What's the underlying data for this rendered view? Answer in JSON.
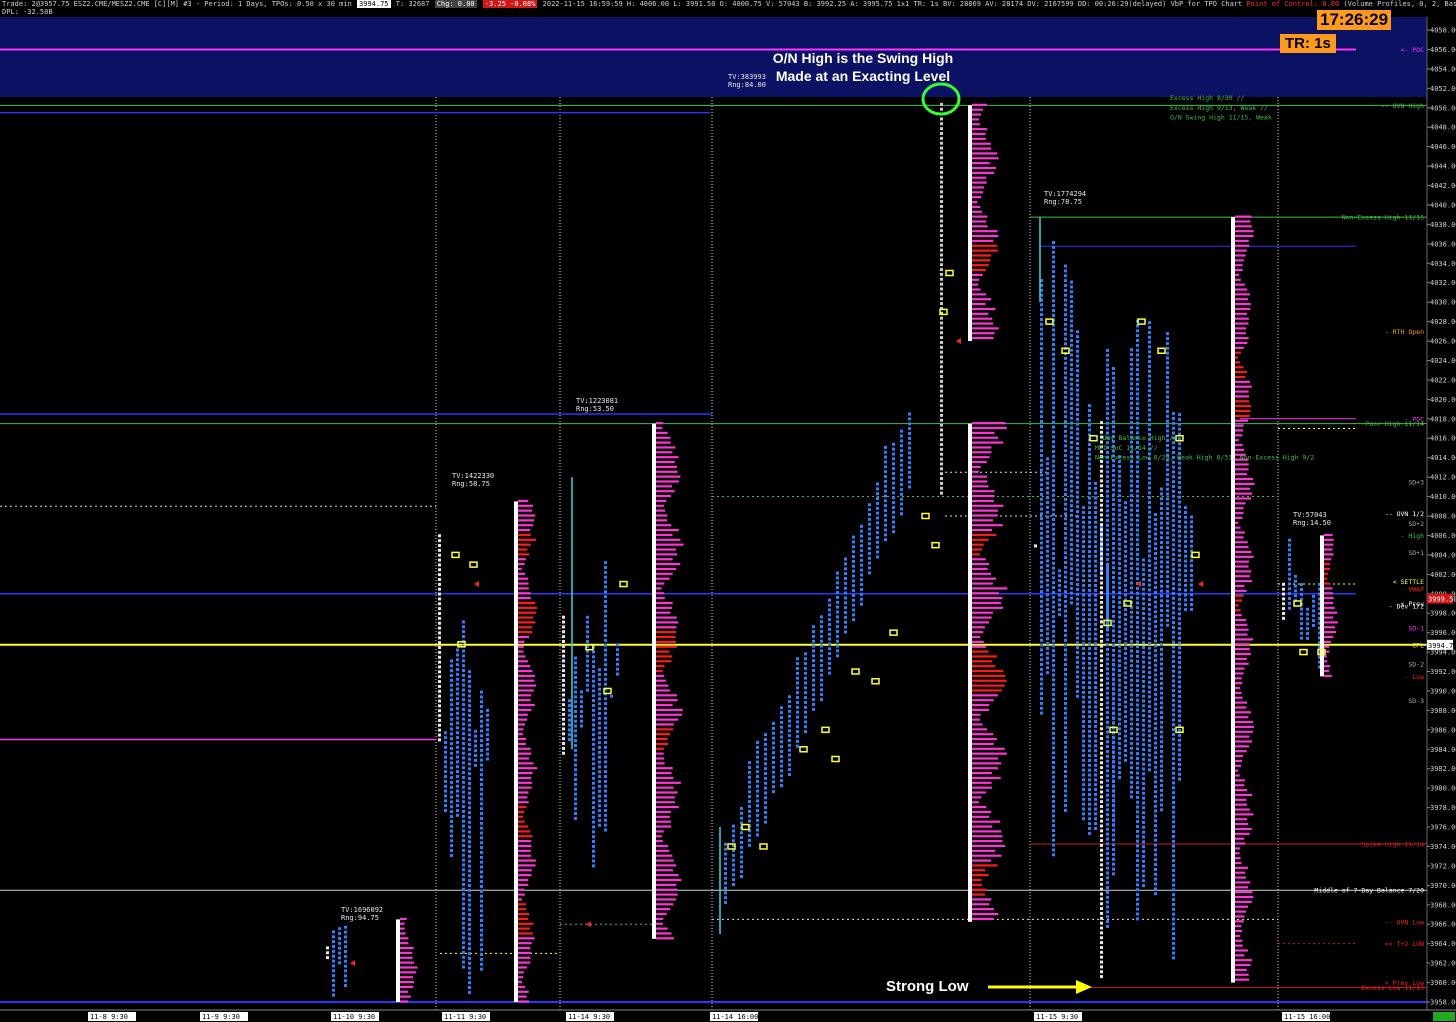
{
  "header": {
    "trade_text": "Trade: 2@3957.75 ESZ2.CME/MESZ2.CME [C][M] #3 - Period: 1 Days, TPOs: 0.50 x 30 min",
    "price_chip": "3994.75",
    "t_text": "T: 32687",
    "chg_text": "Chg: 0.00",
    "neg_chip": "-3.25 -0.08%",
    "info_text": "2022-11-15 16:59:59 H: 4006.00 L: 3991.50 O: 4000.75 V: 57043 B: 3992.25 A: 3995.75 1x1 TR: 1s BV: 28869 AV: 28174 DV: 2167599 DD: 00:26:29(delayed) VbP for TPO Chart",
    "poc_text": "Point of Control: 0.00",
    "vp_text": "(Volume Profiles, 0, 2, Based On TPO Chart, No, Days, 1, 50, 1000000, 0, 0, No, 00:00:00, 0, 00:00:00, No, No, No, Window Width,",
    "second_row": "DPL: -32.50B"
  },
  "clock": "17:26:29",
  "tr_box": "TR: 1s",
  "annotations": {
    "title_line1": "O/N High is the Swing High",
    "title_line2": "Made at an Exacting Level",
    "strong_low": "Strong Low"
  },
  "colors": {
    "background": "#000000",
    "header_band": "#0b1163",
    "accent_orange": "#ff9a1f",
    "tpo_blue": "#2f7fff",
    "volume_magenta": "#ff33d6",
    "volume_red": "#ff1a1a",
    "level_green": "#3fbf3f",
    "level_blue": "#2a35ff",
    "level_yellow": "#ffff33",
    "level_magenta": "#ff33ff",
    "level_red": "#c81e1e",
    "poc_box": "#ffff33"
  },
  "icons": {
    "highlight_circle": "green-circle-icon",
    "arrow": "yellow-right-arrow-icon"
  },
  "chart_data": {
    "type": "tpo-profile",
    "title": "",
    "price_axis": {
      "min": 3958.0,
      "max": 4058.0,
      "ticks": [
        "4058.00",
        "4056.00",
        "4054.00",
        "4052.00",
        "4050.00",
        "4048.00",
        "4046.00",
        "4044.00",
        "4042.00",
        "4040.00",
        "4038.00",
        "4036.00",
        "4034.00",
        "4032.00",
        "4030.00",
        "4028.00",
        "4026.00",
        "4024.00",
        "4022.00",
        "4020.00",
        "4018.00",
        "4016.00",
        "4014.00",
        "4012.00",
        "4010.00",
        "4008.00",
        "4006.00",
        "4004.00",
        "4002.00",
        "4000.00",
        "3998.00",
        "3996.00",
        "3994.00",
        "3992.00",
        "3990.00",
        "3988.00",
        "3986.00",
        "3984.00",
        "3982.00",
        "3980.00",
        "3978.00",
        "3976.00",
        "3974.00",
        "3972.00",
        "3970.00",
        "3968.00",
        "3966.00",
        "3964.00",
        "3962.00",
        "3960.00",
        "3958.00"
      ],
      "current_price": "3994.75",
      "vwap_price": "3999.50"
    },
    "time_axis": [
      "11-8 9:30",
      "11-9 9:30",
      "11-10 9:30",
      "11-11 9:30",
      "11-14 9:30",
      "11-14 16:00",
      "11-15 9:30",
      "11-15 16:00"
    ],
    "sessions": [
      {
        "label": "11-10 9:30",
        "tv": "TV:1696092",
        "rng": "Rng:94.75",
        "high": 3966.5,
        "low": 3958.0,
        "poc": 3962.0
      },
      {
        "label": "11-11 9:30",
        "tv": "TV:1422330",
        "rng": "Rng:58.75",
        "high": 4009.5,
        "low": 3958.0,
        "poc": 3998.5
      },
      {
        "label": "11-14 9:30",
        "tv": "TV:1223081",
        "rng": "Rng:53.50",
        "high": 4017.5,
        "low": 3964.5,
        "poc": 3995.5
      },
      {
        "label": "11-14 16:00",
        "tv": "TV:383993",
        "rng": "Rng:84.00",
        "high": 4050.25,
        "low": 3966.25,
        "poc": 3969.0
      },
      {
        "label": "11-15 9:30",
        "tv": "TV:1774294",
        "rng": "Rng:78.75",
        "high": 4038.75,
        "low": 3960.0,
        "poc": 4030.0
      },
      {
        "label": "11-15 16:00",
        "tv": "TV:57043",
        "rng": "Rng:14.50",
        "high": 4006.0,
        "low": 3991.5,
        "poc": 3999.5
      }
    ],
    "levels": [
      {
        "name": "POC",
        "price": 4056.0,
        "color": "#ff33ff",
        "text": "<- POC"
      },
      {
        "name": "OVN High",
        "price": 4050.25,
        "color": "#3fbf3f",
        "text": "-- OVN High"
      },
      {
        "name": "Non-Excess High 11/15",
        "price": 4038.75,
        "color": "#3fbf3f",
        "text": "Non-Excess High 11/15"
      },
      {
        "name": "Prior blue",
        "price": 4035.75,
        "color": "#2a35ff",
        "text": ""
      },
      {
        "name": "RTH Open",
        "price": 4027.0,
        "color": "#ff9a1f",
        "text": "- RTH Open"
      },
      {
        "name": "POC 2",
        "price": 4018.0,
        "color": "#ff33ff",
        "text": "- POC"
      },
      {
        "name": "Poor High 11/14",
        "price": 4017.5,
        "color": "#3fbf3f",
        "text": "Poor High 11/14"
      },
      {
        "name": "SD+3",
        "price": 4011.5,
        "color": "#aaaaaa",
        "text": "SD+3"
      },
      {
        "name": "OVN 1/2",
        "price": 4008.25,
        "color": "#ffffff",
        "text": "-- OVN 1/2"
      },
      {
        "name": "SD+2",
        "price": 4007.25,
        "color": "#aaaaaa",
        "text": "SD+2"
      },
      {
        "name": "High",
        "price": 4006.0,
        "color": "#3fbf3f",
        "text": "- High"
      },
      {
        "name": "SD+1",
        "price": 4004.25,
        "color": "#aaaaaa",
        "text": "SD+1"
      },
      {
        "name": "SETTLE",
        "price": 4001.25,
        "color": "#ffff33",
        "text": "< SETTLE"
      },
      {
        "name": "VWAP",
        "price": 4000.5,
        "color": "#ff2020",
        "text": "- VWAP"
      },
      {
        "name": "Prev",
        "price": 3999.0,
        "color": "#ffffff",
        "text": "< Prev"
      },
      {
        "name": "Dev 1/2",
        "price": 3998.75,
        "color": "#ffffff",
        "text": "- Dev 1/2"
      },
      {
        "name": "SD-1",
        "price": 3996.5,
        "color": "#ff33ff",
        "text": "SD-1"
      },
      {
        "name": "CPL",
        "price": 3994.75,
        "color": "#ffff33",
        "text": "CPL"
      },
      {
        "name": "SD-2",
        "price": 3992.75,
        "color": "#aaaaaa",
        "text": "SD-2"
      },
      {
        "name": "Low",
        "price": 3991.5,
        "color": "#ff2020",
        "text": "- Low"
      },
      {
        "name": "SD-3",
        "price": 3989.0,
        "color": "#aaaaaa",
        "text": "SD-3"
      },
      {
        "name": "Spike High 11/14",
        "price": 3974.25,
        "color": "#c81e1e",
        "text": "Spike High 11/14"
      },
      {
        "name": "Middle of 7-Day Balance 7/20",
        "price": 3969.5,
        "color": "#ffffff",
        "text": "Middle of 7-Day Balance 7/20"
      },
      {
        "name": "OVN Low",
        "price": 3966.25,
        "color": "#ff2020",
        "text": "-- OVN Low"
      },
      {
        "name": "T+2 LOW",
        "price": 3964.0,
        "color": "#ff2020",
        "text": "<< T+2 LOW"
      },
      {
        "name": "Prev Low",
        "price": 3960.0,
        "color": "#ff2020",
        "text": "< Prev Low"
      },
      {
        "name": "Excess Low 11/15",
        "price": 3959.5,
        "color": "#ff2020",
        "text": "Excess Low 11/15"
      }
    ],
    "notes": [
      {
        "text": "Excess High 8/30 //",
        "price": 4051.0
      },
      {
        "text": "Excess High 9/13, Weak //",
        "price": 4050.0
      },
      {
        "text": "O/N Swing High 11/15, Weak",
        "price": 4049.0
      },
      {
        "text": "7-Day Balance High //",
        "price": 4016.0
      },
      {
        "text": "MPI SoC 11/14 //",
        "price": 4015.0
      },
      {
        "text": "Non-Excess Low 8/29, Weak High 8/31, Non-Excess High 9/2",
        "price": 4014.0
      }
    ]
  }
}
